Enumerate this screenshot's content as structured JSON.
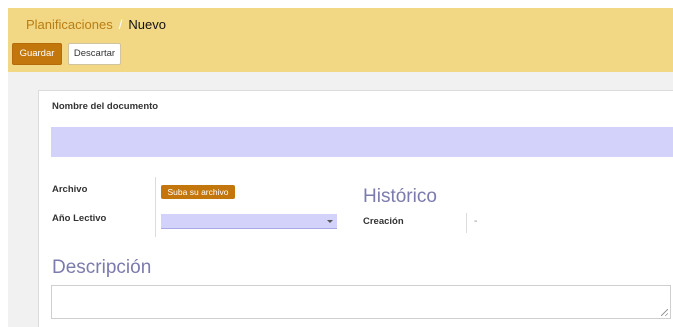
{
  "breadcrumb": {
    "parent": "Planificaciones",
    "separator": "/",
    "current": "Nuevo"
  },
  "toolbar": {
    "save_label": "Guardar",
    "discard_label": "Descartar"
  },
  "form": {
    "name_label": "Nombre del documento",
    "name_value": "",
    "archivo_label": "Archivo",
    "upload_button_label": "Suba su archivo",
    "anio_label": "Año Lectivo",
    "anio_value": "",
    "historico_title": "Histórico",
    "creacion_label": "Creación",
    "creacion_value": "-",
    "descripcion_title": "Descripción",
    "descripcion_value": ""
  },
  "icons": {
    "select_arrow": "chevron-down-icon",
    "resize_grip": "resize-grip-icon"
  },
  "colors": {
    "control_panel_bg": "#f2d784",
    "primary_button": "#c3760c",
    "required_field_bg": "#d2d2fb",
    "section_title": "#7c7bad",
    "breadcrumb_link": "#b87e16"
  }
}
